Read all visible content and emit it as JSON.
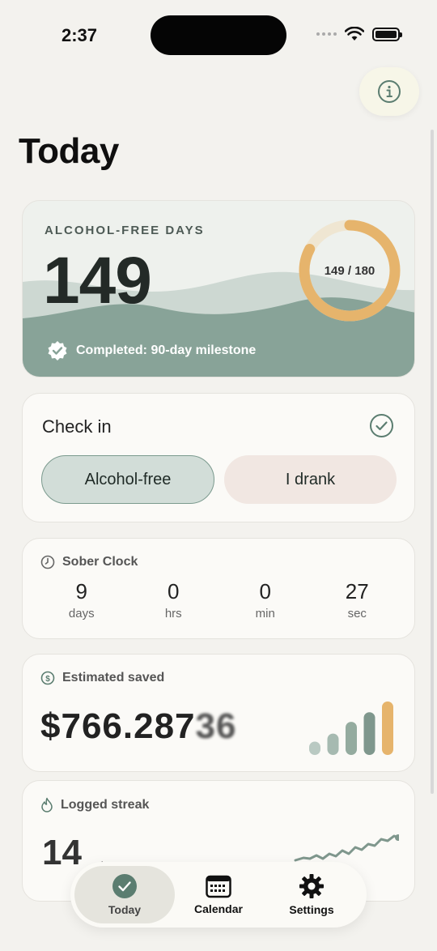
{
  "status_bar": {
    "time": "2:37"
  },
  "page_title": "Today",
  "hero": {
    "label": "ALCOHOL-FREE DAYS",
    "days": "149",
    "progress_text": "149 / 180",
    "progress_fraction": 0.8278,
    "milestone": "Completed: 90-day milestone",
    "colors": {
      "wave_dark": "#88a398",
      "ring": "#e6b46c"
    }
  },
  "checkin": {
    "title": "Check in",
    "alcohol_free_label": "Alcohol-free",
    "drank_label": "I drank"
  },
  "sober_clock": {
    "title": "Sober Clock",
    "units": [
      {
        "value": "9",
        "label": "days"
      },
      {
        "value": "0",
        "label": "hrs"
      },
      {
        "value": "0",
        "label": "min"
      },
      {
        "value": "27",
        "label": "sec"
      }
    ]
  },
  "saved": {
    "title": "Estimated saved",
    "value": "$766.287",
    "value_tail": "36",
    "bar_levels": [
      0.25,
      0.4,
      0.62,
      0.8,
      1.0
    ]
  },
  "streak": {
    "title": "Logged streak",
    "value": "14",
    "unit": "days"
  },
  "tabs": {
    "today": "Today",
    "calendar": "Calendar",
    "settings": "Settings"
  }
}
